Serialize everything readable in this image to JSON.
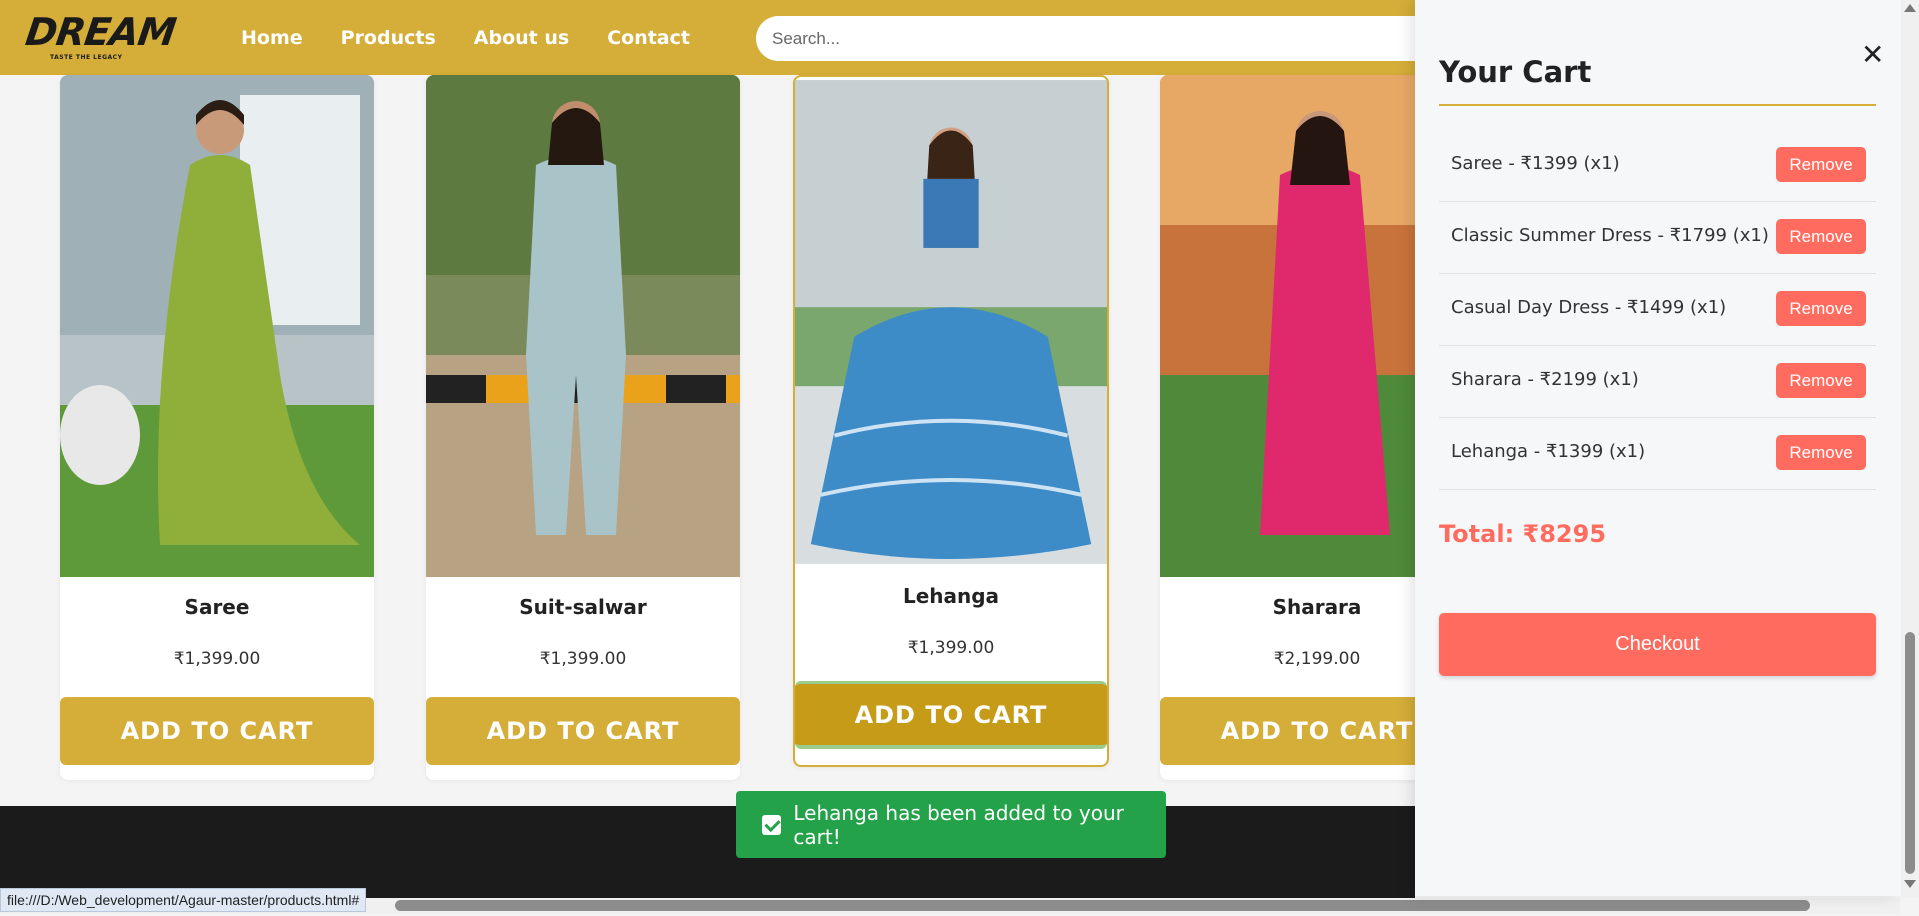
{
  "header": {
    "logo_text": "DREAM",
    "logo_tagline": "TASTE THE LEGACY",
    "nav": [
      "Home",
      "Products",
      "About us",
      "Contact"
    ],
    "search_placeholder": "Search..."
  },
  "products": [
    {
      "title": "Saree",
      "price": "₹1,399.00",
      "button": "ADD TO CART"
    },
    {
      "title": "Suit-salwar",
      "price": "₹1,399.00",
      "button": "ADD TO CART"
    },
    {
      "title": "Lehanga",
      "price": "₹1,399.00",
      "button": "ADD TO CART"
    },
    {
      "title": "Sharara",
      "price": "₹2,199.00",
      "button": "ADD TO CART"
    }
  ],
  "toast": {
    "message": "Lehanga has been added to your cart!"
  },
  "status_bar": {
    "url": "file:///D:/Web_development/Agaur-master/products.html#"
  },
  "cart": {
    "title": "Your Cart",
    "close_symbol": "✕",
    "items": [
      {
        "label": "Saree - ₹1399 (x1)",
        "remove": "Remove"
      },
      {
        "label": "Classic Summer Dress - ₹1799 (x1)",
        "remove": "Remove"
      },
      {
        "label": "Casual Day Dress - ₹1499 (x1)",
        "remove": "Remove"
      },
      {
        "label": "Sharara - ₹2199 (x1)",
        "remove": "Remove"
      },
      {
        "label": "Lehanga - ₹1399 (x1)",
        "remove": "Remove"
      }
    ],
    "total": "Total: ₹8295",
    "checkout": "Checkout"
  },
  "colors": {
    "brand_gold": "#d4ae38",
    "accent_coral": "#ff6b5f",
    "toast_green": "#23a24a",
    "footer_dark": "#1b1b1b"
  }
}
